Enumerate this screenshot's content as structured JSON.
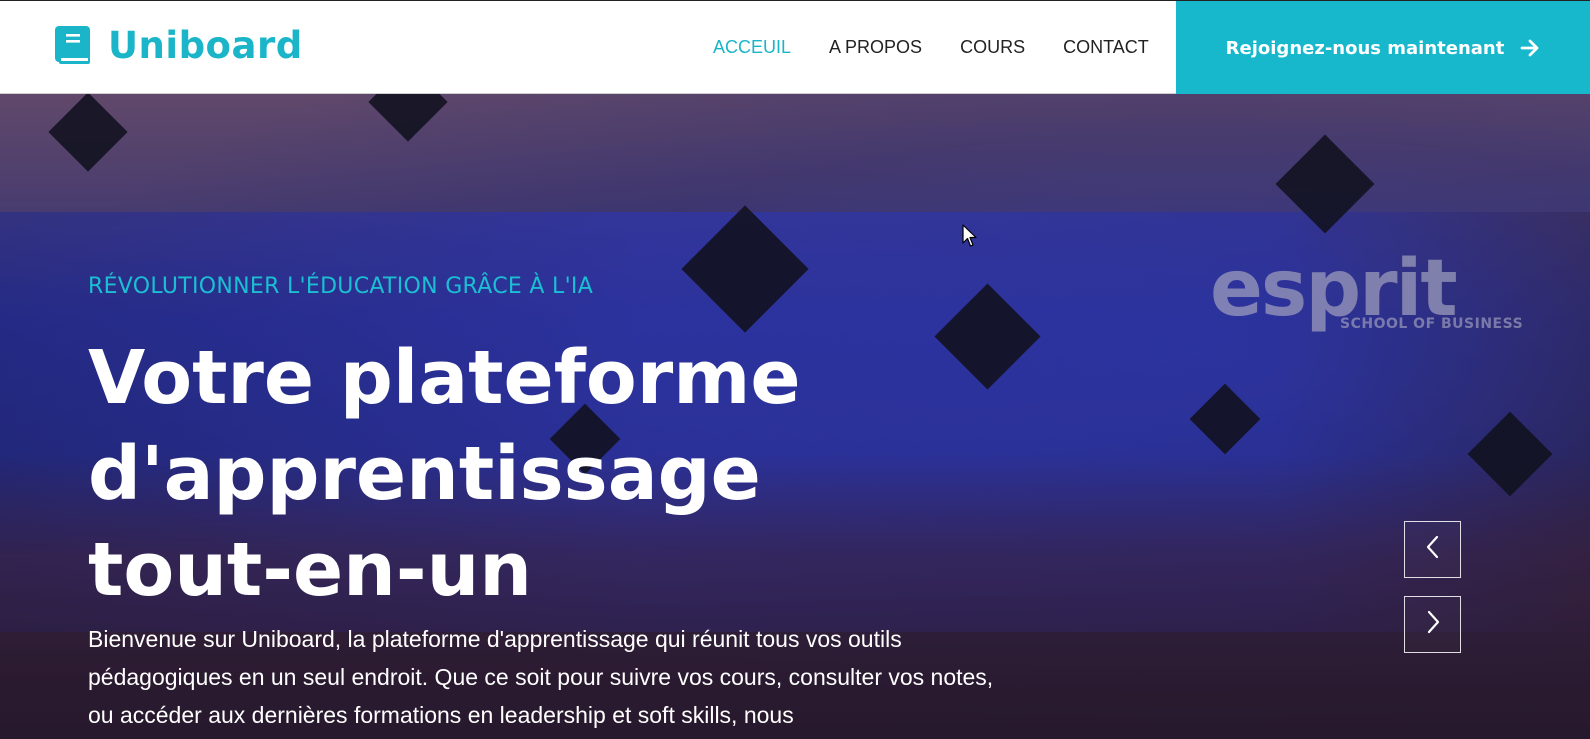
{
  "brand": {
    "name": "Uniboard",
    "color": "#1bb5c9"
  },
  "nav": {
    "items": [
      {
        "label": "ACCEUIL",
        "active": true
      },
      {
        "label": "A PROPOS",
        "active": false
      },
      {
        "label": "COURS",
        "active": false
      },
      {
        "label": "CONTACT",
        "active": false
      }
    ]
  },
  "cta": {
    "label": "Rejoignez-nous maintenant",
    "icon": "arrow-right-icon",
    "color": "#17b8cc"
  },
  "hero": {
    "tagline": "RÉVOLUTIONNER L'ÉDUCATION GRÂCE À L'IA",
    "title": "Votre plateforme d'apprentissage tout-en-un",
    "description": "Bienvenue sur Uniboard, la plateforme d'apprentissage qui réunit tous vos outils pédagogiques en un seul endroit. Que ce soit pour suivre vos cours, consulter vos notes, ou accéder aux dernières formations en leadership et soft skills, nous",
    "background_sign": {
      "main": "esprit",
      "sub": "SCHOOL OF BUSINESS"
    }
  },
  "slider": {
    "prev_icon": "chevron-left-icon",
    "next_icon": "chevron-right-icon"
  }
}
